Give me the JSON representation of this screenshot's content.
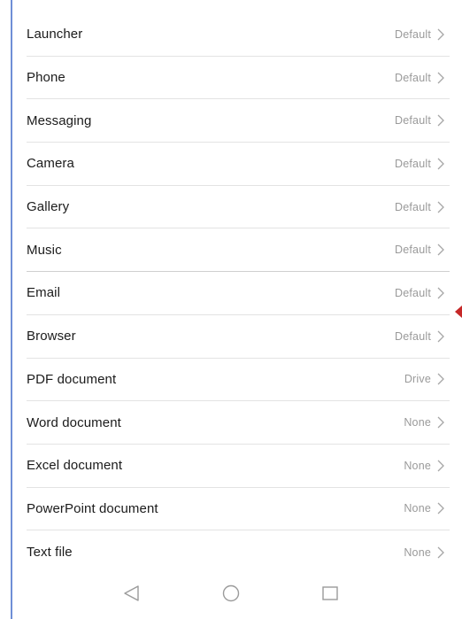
{
  "default_apps": [
    {
      "label": "Launcher",
      "value": "Default"
    },
    {
      "label": "Phone",
      "value": "Default"
    },
    {
      "label": "Messaging",
      "value": "Default"
    },
    {
      "label": "Camera",
      "value": "Default"
    },
    {
      "label": "Gallery",
      "value": "Default"
    },
    {
      "label": "Music",
      "value": "Default"
    },
    {
      "label": "Email",
      "value": "Default"
    },
    {
      "label": "Browser",
      "value": "Default"
    },
    {
      "label": "PDF document",
      "value": "Drive"
    },
    {
      "label": "Word document",
      "value": "None"
    },
    {
      "label": "Excel document",
      "value": "None"
    },
    {
      "label": "PowerPoint document",
      "value": "None"
    },
    {
      "label": "Text file",
      "value": "None"
    }
  ],
  "navigation": {
    "back_icon": "triangle-back-icon",
    "home_icon": "circle-home-icon",
    "recents_icon": "square-recents-icon"
  },
  "colors": {
    "label": "#1b1b1b",
    "value": "#9a9a9a",
    "divider": "#e3e3e3",
    "edge_accent": "#6f8fd6",
    "marker": "#c62828"
  }
}
